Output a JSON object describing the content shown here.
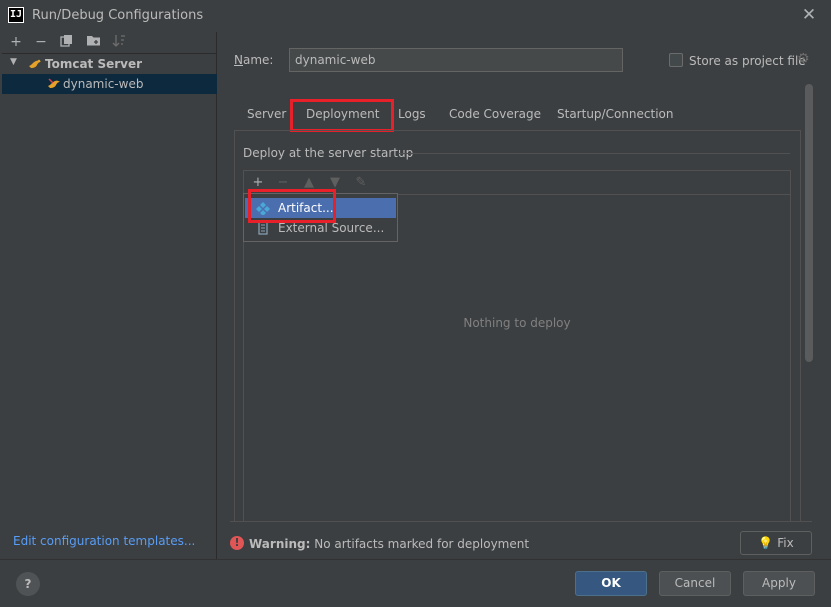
{
  "window": {
    "title": "Run/Debug Configurations",
    "app_icon": "IJ"
  },
  "left_toolbar": [
    "add-icon",
    "remove-icon",
    "copy-icon",
    "folder-icon",
    "sort-icon"
  ],
  "tree": {
    "root": {
      "label": "Tomcat Server",
      "expanded": true
    },
    "child": {
      "label": "dynamic-web",
      "selected": true
    }
  },
  "edit_templates_link": "Edit configuration templates...",
  "form": {
    "name_label": "Name:",
    "name_value": "dynamic-web",
    "store_label": "Store as project file",
    "store_checked": false
  },
  "tabs": {
    "server": "Server",
    "deployment": "Deployment",
    "logs": "Logs",
    "coverage": "Code Coverage",
    "startup": "Startup/Connection",
    "active": "Deployment"
  },
  "deploy": {
    "group_title": "Deploy at the server startup",
    "empty_message": "Nothing to deploy",
    "toolbar": [
      "add-icon",
      "remove-icon",
      "move-up-icon",
      "move-down-icon",
      "edit-icon"
    ]
  },
  "popup_menu": {
    "items": [
      "Artifact...",
      "External Source..."
    ],
    "selected": "Artifact..."
  },
  "warning": {
    "prefix": "Warning:",
    "message": "No artifacts marked for deployment",
    "fix_label": "Fix"
  },
  "buttons": {
    "help": "?",
    "ok": "OK",
    "cancel": "Cancel",
    "apply": "Apply"
  },
  "colors": {
    "background": "#3c3f41",
    "selection": "#4b6eaf",
    "tree_selection": "#0d293e",
    "link": "#589df6",
    "highlight_box": "#e8202a",
    "primary_button": "#365880"
  }
}
